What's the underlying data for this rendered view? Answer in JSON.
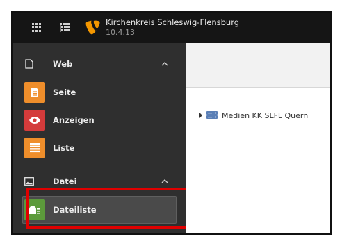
{
  "topbar": {
    "site_title": "Kirchenkreis Schleswig-Flensburg",
    "version": "10.4.13",
    "logo_color": "#f49700",
    "buttons": [
      {
        "icon": "modules-grid-icon"
      },
      {
        "icon": "tree-toggle-icon"
      }
    ]
  },
  "sidebar": {
    "groups": [
      {
        "label": "Web",
        "icon": "document-icon",
        "items": [
          {
            "label": "Seite",
            "icon": "page-icon",
            "color": "#ef8e2b"
          },
          {
            "label": "Anzeigen",
            "icon": "eye-icon",
            "color": "#d43b3b"
          },
          {
            "label": "Liste",
            "icon": "list-icon",
            "color": "#ef8e2b"
          }
        ]
      },
      {
        "label": "Datei",
        "icon": "image-icon",
        "items": [
          {
            "label": "Dateiliste",
            "icon": "filelist-icon",
            "color": "#5c9a3b",
            "active": true
          }
        ]
      }
    ]
  },
  "main": {
    "tree": [
      {
        "label": "Medien KK SLFL Quern",
        "icon": "file-storage-icon"
      }
    ]
  }
}
